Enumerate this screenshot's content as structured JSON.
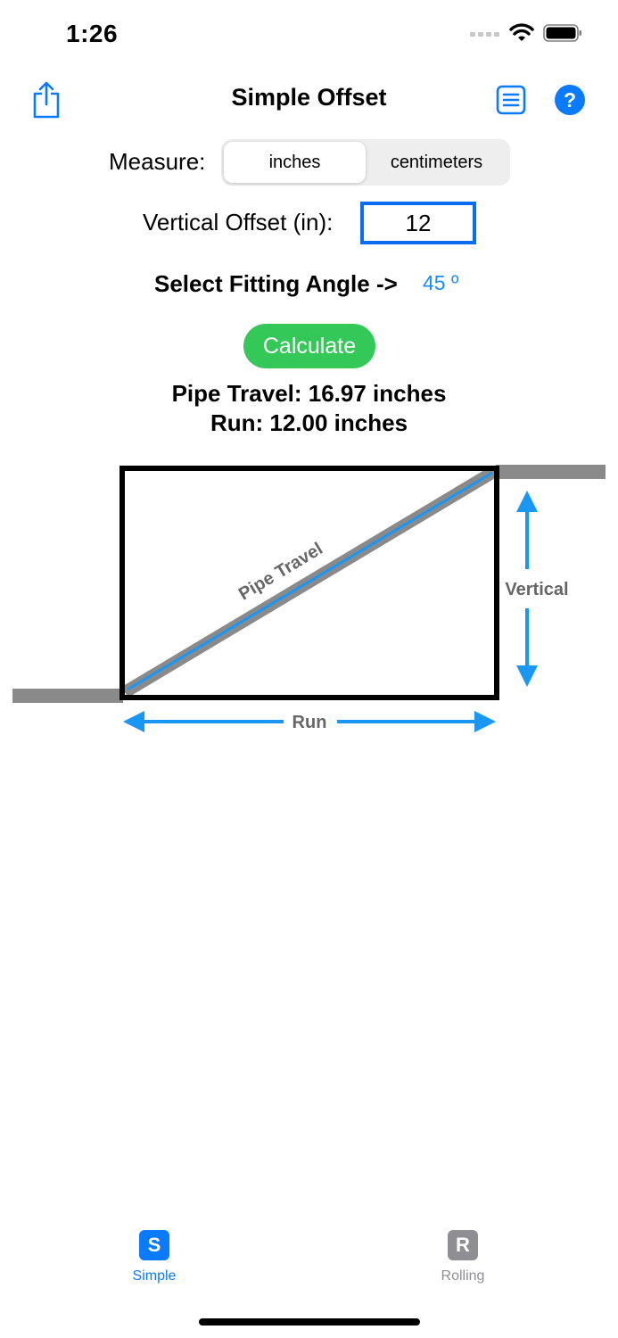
{
  "status_bar": {
    "time": "1:26"
  },
  "nav": {
    "title": "Simple Offset",
    "share_icon": "share-icon",
    "list_icon": "list-icon",
    "help_icon": "help-icon"
  },
  "measure": {
    "label": "Measure:",
    "options": [
      "inches",
      "centimeters"
    ],
    "selected": "inches"
  },
  "vertical_offset": {
    "label": "Vertical Offset (in):",
    "value": "12"
  },
  "fitting_angle": {
    "label": "Select Fitting Angle ->",
    "value": "45 º"
  },
  "calculate": {
    "label": "Calculate"
  },
  "results": {
    "pipe_travel": "Pipe Travel: 16.97 inches",
    "run": "Run: 12.00 inches"
  },
  "diagram": {
    "pipe_travel_label": "Pipe Travel",
    "vertical_label": "Vertical",
    "run_label": "Run"
  },
  "tabs": [
    {
      "badge": "S",
      "label": "Simple",
      "active": true
    },
    {
      "badge": "R",
      "label": "Rolling",
      "active": false
    }
  ],
  "colors": {
    "accent": "#0a7aff",
    "calculate": "#34c859",
    "diagram_arrow": "#1a97f5",
    "pipe": "#8a8a8a",
    "inactive": "#8e8e93"
  }
}
